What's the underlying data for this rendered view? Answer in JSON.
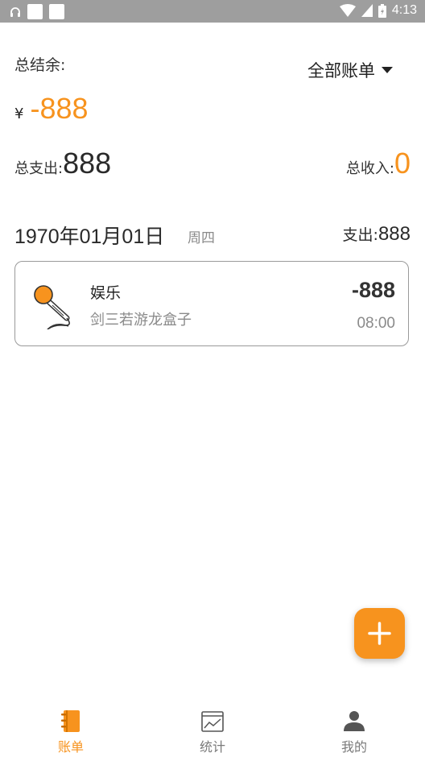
{
  "status_bar": {
    "time": "4:13",
    "icons": [
      "headset-icon",
      "app-square-icon",
      "app-square-icon",
      "wifi-icon",
      "signal-icon",
      "battery-icon"
    ]
  },
  "summary": {
    "total_balance_label": "总结余:",
    "filter_label": "全部账单",
    "currency_symbol": "¥",
    "balance_value": "-888",
    "total_expense_label": "总支出:",
    "total_expense_value": "888",
    "total_income_label": "总收入:",
    "total_income_value": "0"
  },
  "day_group": {
    "date": "1970年01月01日",
    "weekday": "周四",
    "expense_label": "支出:",
    "expense_value": "888"
  },
  "transactions": [
    {
      "category": "娱乐",
      "note": "剑三若游龙盒子",
      "amount": "-888",
      "time": "08:00",
      "icon": "microphone-icon"
    }
  ],
  "fab": {
    "icon": "plus-icon"
  },
  "tabs": [
    {
      "label": "账单",
      "icon": "ledger-book-icon",
      "active": true
    },
    {
      "label": "统计",
      "icon": "chart-icon",
      "active": false
    },
    {
      "label": "我的",
      "icon": "profile-icon",
      "active": false
    }
  ],
  "colors": {
    "accent": "#f7931e",
    "status_bar": "#9e9e9e",
    "text_primary": "#2a2a2a",
    "text_secondary": "#8a8a8a"
  }
}
